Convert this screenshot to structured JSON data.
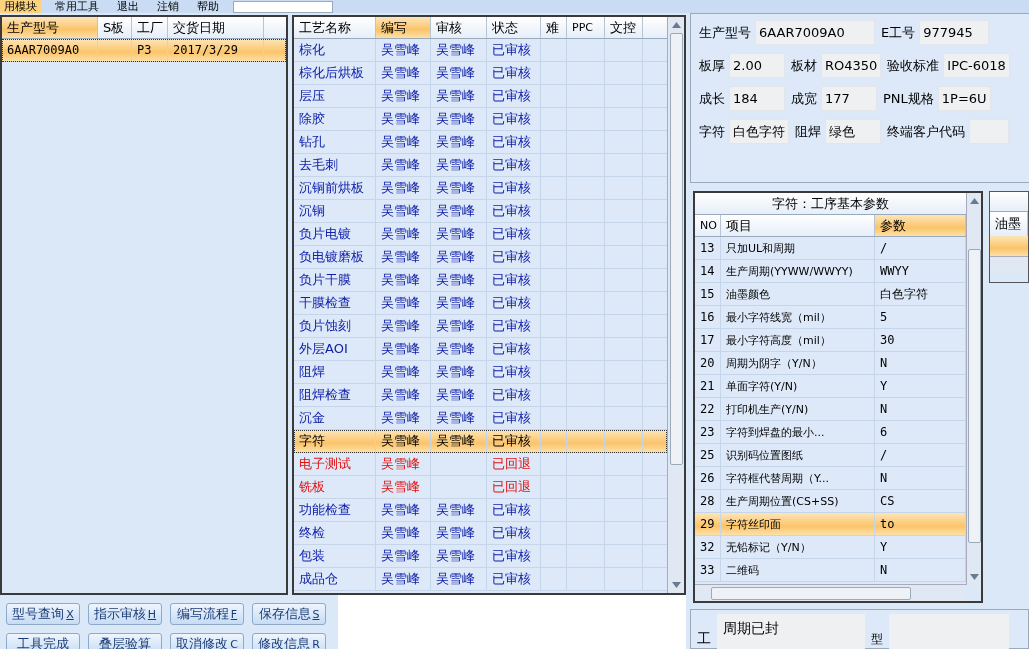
{
  "menu": [
    {
      "label": "用模块",
      "selected": true
    },
    {
      "label": "常用工具",
      "selected": false
    },
    {
      "label": "退出",
      "selected": false
    },
    {
      "label": "注销",
      "selected": false
    },
    {
      "label": "帮助",
      "selected": false
    }
  ],
  "models": {
    "columns": [
      {
        "label": "生产型号",
        "selected": true
      },
      {
        "label": "S板",
        "selected": false
      },
      {
        "label": "工厂",
        "selected": false
      },
      {
        "label": "交货日期",
        "selected": false
      }
    ],
    "rows": [
      {
        "cells": [
          "6AAR7009A0",
          "",
          "P3",
          "2017/3/29"
        ],
        "selected": true
      }
    ]
  },
  "buttons": [
    {
      "label": "型号查询",
      "key": "X"
    },
    {
      "label": "指示审核",
      "key": "H"
    },
    {
      "label": "编写流程",
      "key": "F"
    },
    {
      "label": "保存信息",
      "key": "S"
    },
    {
      "label": "工具完成"
    },
    {
      "label": "叠层验算"
    },
    {
      "label": "取消修改",
      "key": "C"
    },
    {
      "label": "修改信息",
      "key": "R"
    }
  ],
  "process": {
    "columns": [
      {
        "label": "工艺名称",
        "selected": false
      },
      {
        "label": "编写",
        "selected": true
      },
      {
        "label": "审核",
        "selected": false
      },
      {
        "label": "状态",
        "selected": false
      },
      {
        "label": "难",
        "selected": false
      },
      {
        "label": "PPC",
        "selected": false
      },
      {
        "label": "文控",
        "selected": false
      }
    ],
    "rows": [
      {
        "name": "棕化",
        "writer": "吴雪峰",
        "reviewer": "吴雪峰",
        "status": "已审核",
        "kind": "approved",
        "selected": false
      },
      {
        "name": "棕化后烘板",
        "writer": "吴雪峰",
        "reviewer": "吴雪峰",
        "status": "已审核",
        "kind": "approved",
        "selected": false
      },
      {
        "name": "层压",
        "writer": "吴雪峰",
        "reviewer": "吴雪峰",
        "status": "已审核",
        "kind": "approved",
        "selected": false
      },
      {
        "name": "除胶",
        "writer": "吴雪峰",
        "reviewer": "吴雪峰",
        "status": "已审核",
        "kind": "approved",
        "selected": false
      },
      {
        "name": "钻孔",
        "writer": "吴雪峰",
        "reviewer": "吴雪峰",
        "status": "已审核",
        "kind": "approved",
        "selected": false
      },
      {
        "name": "去毛刺",
        "writer": "吴雪峰",
        "reviewer": "吴雪峰",
        "status": "已审核",
        "kind": "approved",
        "selected": false
      },
      {
        "name": "沉铜前烘板",
        "writer": "吴雪峰",
        "reviewer": "吴雪峰",
        "status": "已审核",
        "kind": "approved",
        "selected": false
      },
      {
        "name": "沉铜",
        "writer": "吴雪峰",
        "reviewer": "吴雪峰",
        "status": "已审核",
        "kind": "approved",
        "selected": false
      },
      {
        "name": "负片电镀",
        "writer": "吴雪峰",
        "reviewer": "吴雪峰",
        "status": "已审核",
        "kind": "approved",
        "selected": false
      },
      {
        "name": "负电镀磨板",
        "writer": "吴雪峰",
        "reviewer": "吴雪峰",
        "status": "已审核",
        "kind": "approved",
        "selected": false
      },
      {
        "name": "负片干膜",
        "writer": "吴雪峰",
        "reviewer": "吴雪峰",
        "status": "已审核",
        "kind": "approved",
        "selected": false
      },
      {
        "name": "干膜检查",
        "writer": "吴雪峰",
        "reviewer": "吴雪峰",
        "status": "已审核",
        "kind": "approved",
        "selected": false
      },
      {
        "name": "负片蚀刻",
        "writer": "吴雪峰",
        "reviewer": "吴雪峰",
        "status": "已审核",
        "kind": "approved",
        "selected": false
      },
      {
        "name": "外层AOI",
        "writer": "吴雪峰",
        "reviewer": "吴雪峰",
        "status": "已审核",
        "kind": "approved",
        "selected": false
      },
      {
        "name": "阻焊",
        "writer": "吴雪峰",
        "reviewer": "吴雪峰",
        "status": "已审核",
        "kind": "approved",
        "selected": false
      },
      {
        "name": "阻焊检查",
        "writer": "吴雪峰",
        "reviewer": "吴雪峰",
        "status": "已审核",
        "kind": "approved",
        "selected": false
      },
      {
        "name": "沉金",
        "writer": "吴雪峰",
        "reviewer": "吴雪峰",
        "status": "已审核",
        "kind": "approved",
        "selected": false
      },
      {
        "name": "字符",
        "writer": "吴雪峰",
        "reviewer": "吴雪峰",
        "status": "已审核",
        "kind": "approved",
        "selected": true
      },
      {
        "name": "电子测试",
        "writer": "吴雪峰",
        "status": "已回退",
        "kind": "returned",
        "selected": false
      },
      {
        "name": "铣板",
        "writer": "吴雪峰",
        "status": "已回退",
        "kind": "returned",
        "selected": false
      },
      {
        "name": "功能检查",
        "writer": "吴雪峰",
        "reviewer": "吴雪峰",
        "status": "已审核",
        "kind": "approved",
        "selected": false
      },
      {
        "name": "终检",
        "writer": "吴雪峰",
        "reviewer": "吴雪峰",
        "status": "已审核",
        "kind": "approved",
        "selected": false
      },
      {
        "name": "包装",
        "writer": "吴雪峰",
        "reviewer": "吴雪峰",
        "status": "已审核",
        "kind": "approved",
        "selected": false
      },
      {
        "name": "成品仓",
        "writer": "吴雪峰",
        "reviewer": "吴雪峰",
        "status": "已审核",
        "kind": "approved",
        "selected": false
      }
    ]
  },
  "info": [
    [
      {
        "label": "生产型号",
        "value": "6AAR7009A0"
      },
      {
        "label": "E工号",
        "value": "977945"
      }
    ],
    [
      {
        "label": "板厚",
        "value": "2.00"
      },
      {
        "label": "板材",
        "value": "RO4350"
      },
      {
        "label": "验收标准",
        "value": "IPC-6018"
      }
    ],
    [
      {
        "label": "成长",
        "value": "184"
      },
      {
        "label": "成宽",
        "value": "177"
      },
      {
        "label": "PNL规格",
        "value": "1P=6U"
      }
    ],
    [
      {
        "label": "字符",
        "value": "白色字符"
      },
      {
        "label": "阻焊",
        "value": "绿色"
      },
      {
        "label": "终端客户代码"
      }
    ]
  ],
  "params": {
    "title": "字符：工序基本参数",
    "columns": [
      {
        "label": "NO",
        "selected": false
      },
      {
        "label": "项目",
        "selected": false
      },
      {
        "label": "参数",
        "selected": true
      }
    ],
    "rows": [
      {
        "no": "13",
        "item": "只加UL和周期",
        "value": "/",
        "selected": false
      },
      {
        "no": "14",
        "item": "生产周期(YYWW/WWYY)",
        "value": "WWYY",
        "selected": false
      },
      {
        "no": "15",
        "item": "油墨颜色",
        "value": "白色字符",
        "selected": false
      },
      {
        "no": "16",
        "item": "最小字符线宽（mil）",
        "value": "5",
        "selected": false
      },
      {
        "no": "17",
        "item": "最小字符高度（mil）",
        "value": "30",
        "selected": false
      },
      {
        "no": "20",
        "item": "周期为阴字（Y/N）",
        "value": "N",
        "selected": false
      },
      {
        "no": "21",
        "item": "单面字符(Y/N)",
        "value": "Y",
        "selected": false
      },
      {
        "no": "22",
        "item": "打印机生产(Y/N)",
        "value": "N",
        "selected": false
      },
      {
        "no": "23",
        "item": "字符到焊盘的最小...",
        "value": "6",
        "selected": false
      },
      {
        "no": "25",
        "item": "识别码位置图纸",
        "value": "/",
        "selected": false
      },
      {
        "no": "26",
        "item": "字符框代替周期（Y...",
        "value": "N",
        "selected": false
      },
      {
        "no": "28",
        "item": "生产周期位置(CS+SS)",
        "value": "CS",
        "selected": false
      },
      {
        "no": "29",
        "item": "字符丝印面",
        "value": "to",
        "selected": true
      },
      {
        "no": "32",
        "item": "无铅标记（Y/N）",
        "value": "Y",
        "selected": false
      },
      {
        "no": "33",
        "item": "二维码",
        "value": "N",
        "selected": false
      }
    ]
  },
  "side_grid": {
    "column": "油墨"
  },
  "bottom": {
    "label_1": "工",
    "note": "周期已封",
    "label_2": "型"
  }
}
